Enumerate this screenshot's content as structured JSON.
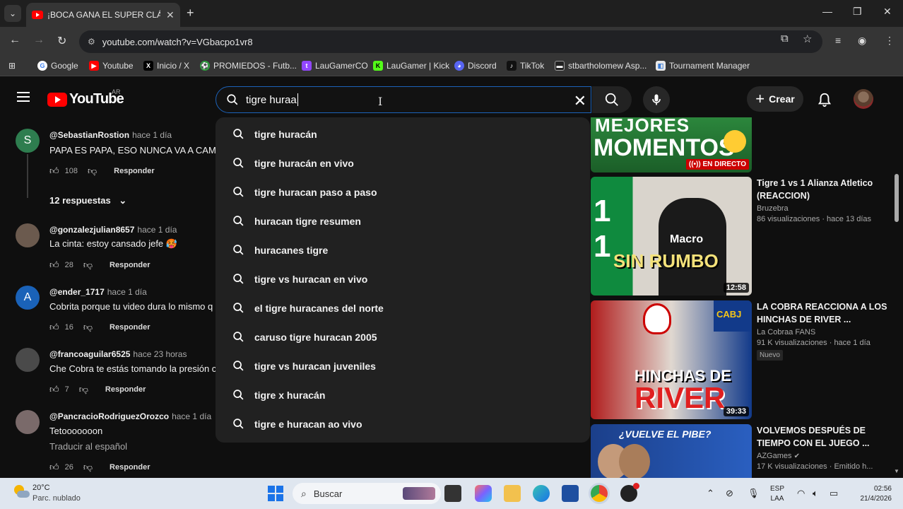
{
  "browser": {
    "tab_title": "¡BOCA GANA EL SUPER CLÁSICO",
    "url": "youtube.com/watch?v=VGbacpo1vr8",
    "bookmarks": [
      {
        "label": "Google",
        "icon": "google-icon",
        "color": "#4285f4"
      },
      {
        "label": "Youtube",
        "icon": "youtube-icon",
        "color": "#ff0000"
      },
      {
        "label": "Inicio / X",
        "icon": "x-icon",
        "color": "#000000"
      },
      {
        "label": "PROMIEDOS - Futb...",
        "icon": "promiedos-icon",
        "color": "#2e9e3e"
      },
      {
        "label": "LauGamerCO",
        "icon": "twitch-icon",
        "color": "#9146ff"
      },
      {
        "label": "LauGamer | Kick",
        "icon": "kick-icon",
        "color": "#53fc18"
      },
      {
        "label": "Discord",
        "icon": "discord-icon",
        "color": "#5865f2"
      },
      {
        "label": "TikTok",
        "icon": "tiktok-icon",
        "color": "#111111"
      },
      {
        "label": "stbartholomew Asp...",
        "icon": "site-icon",
        "color": "#222222"
      },
      {
        "label": "Tournament Manager",
        "icon": "tournament-icon",
        "color": "#e8e8e8"
      }
    ]
  },
  "yt": {
    "logo_text": "YouTube",
    "country": "AR",
    "search_value": "tigre huraa",
    "create_label": "Crear"
  },
  "suggestions": [
    "tigre huracán",
    "tigre huracán en vivo",
    "tigre huracan paso a paso",
    "huracan tigre resumen",
    "huracanes tigre",
    "tigre vs huracan en vivo",
    "el tigre huracanes del norte",
    "caruso tigre huracan 2005",
    "tigre vs huracan juveniles",
    "tigre x huracán",
    "tigre e huracan ao vivo"
  ],
  "comments": [
    {
      "initial": "S",
      "avatar_color": "#2e7d4f",
      "author": "@SebastianRostion",
      "time": "hace 1 día",
      "text": "PAPA ES PAPA, ESO NUNCA VA A CAMB",
      "likes": "108",
      "reply": "Responder"
    },
    {
      "initial": "",
      "avatar_color": "#6b5a4e",
      "author": "@gonzalezjulian8657",
      "time": "hace 1 día",
      "text": "La cinta: estoy cansado jefe 🥵",
      "likes": "28",
      "reply": "Responder"
    },
    {
      "initial": "A",
      "avatar_color": "#1a62b8",
      "author": "@ender_1717",
      "time": "hace 1 día",
      "text": "Cobrita porque tu video dura lo mismo q",
      "likes": "16",
      "reply": "Responder"
    },
    {
      "initial": "",
      "avatar_color": "#4a4a4a",
      "author": "@francoaguilar6525",
      "time": "hace 23 horas",
      "text": "Che Cobra te estás tomando la presión c",
      "likes": "7",
      "reply": "Responder"
    },
    {
      "initial": "",
      "avatar_color": "#7a6a6a",
      "author": "@PancracioRodriguezOrozco",
      "time": "hace 1 día",
      "text": "Tetooooooon",
      "translate": "Traducir al español",
      "likes": "26",
      "reply": "Responder"
    }
  ],
  "replies_label": "12 respuestas",
  "videos": [
    {
      "thumb_lines": [
        "MEJORES",
        "MOMENTOS"
      ],
      "live_badge": "EN DIRECTO"
    },
    {
      "title": "Tigre 1 vs 1 Alianza Atletico (REACCION)",
      "channel": "Bruzebra",
      "meta": "86 visualizaciones · hace 13 días",
      "duration": "12:58",
      "thumb_text": "SIN RUMBO",
      "thumb_jersey": "Macro",
      "thumb_score": "1"
    },
    {
      "title": "LA COBRA REACCIONA A LOS HINCHAS DE RIVER ...",
      "channel": "La Cobraa FANS",
      "meta": "91 K visualizaciones · hace 1 día",
      "badge": "Nuevo",
      "duration": "39:33",
      "thumb_lines": [
        "HINCHAS DE",
        "RIVER"
      ],
      "thumb_badge": "CABJ"
    },
    {
      "title": "VOLVEMOS DESPUÉS DE TIEMPO CON EL JUEGO ...",
      "channel": "AZGames",
      "meta": "17 K visualizaciones · Emitido h...",
      "thumb_text": "¿VUELVE EL PIBE?"
    }
  ],
  "taskbar": {
    "temp": "20°C",
    "weather": "Parc. nublado",
    "search_placeholder": "Buscar",
    "lang_1": "ESP",
    "lang_2": "LAA",
    "time": "02:56",
    "date": "21/4/2026"
  }
}
